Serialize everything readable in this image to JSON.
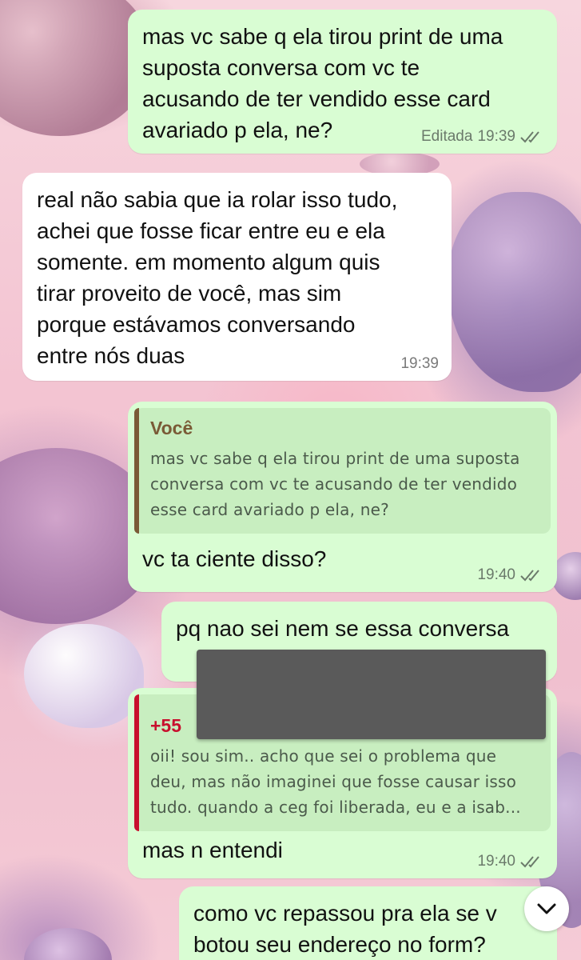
{
  "chat": {
    "messages": [
      {
        "direction": "out",
        "text": "mas vc sabe q ela tirou print de uma\nsuposta conversa com vc te\nacusando de ter vendido esse card\navariado p ela, ne?",
        "edited_label": "Editada",
        "time": "19:39",
        "status": "read"
      },
      {
        "direction": "in",
        "text": "real não sabia que ia rolar isso tudo,\nachei que fosse ficar entre eu e ela\nsomente. em momento algum quis\ntirar proveito de você, mas sim\nporque estávamos conversando\nentre nós duas",
        "time": "19:39"
      },
      {
        "direction": "out",
        "quote": {
          "author": "Você",
          "text": "mas vc sabe q ela tirou print de uma suposta\nconversa com vc te acusando de ter vendido\nesse card avariado p ela, ne?"
        },
        "text": "vc ta ciente disso?",
        "time": "19:40",
        "status": "read"
      },
      {
        "direction": "out",
        "text": "pq nao sei nem se essa conversa"
      },
      {
        "direction": "out",
        "quote": {
          "author": "+55",
          "text": "oii! sou sim.. acho que sei o problema que\ndeu, mas não imaginei que fosse causar isso\ntudo. quando a ceg foi liberada, eu e a isab..."
        },
        "text": "mas n entendi",
        "time": "19:40",
        "status": "read"
      },
      {
        "direction": "out",
        "text": "como vc repassou pra ela se v\nbotou seu endereço no form?"
      }
    ]
  },
  "colors": {
    "outgoing_bubble": "#d9fdd3",
    "incoming_bubble": "#ffffff",
    "quote_bar_self": "#7a5a36",
    "quote_bar_contact": "#c8102e",
    "quote_author_contact": "#c8102e",
    "read_ticks": "#6b7a6b"
  },
  "icons": {
    "read_receipt": "double-check-icon",
    "scroll_down": "chevron-down-icon"
  }
}
